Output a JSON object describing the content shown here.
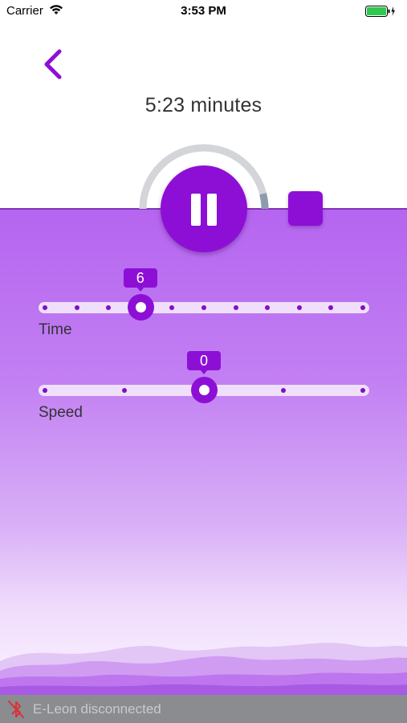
{
  "status_bar": {
    "carrier": "Carrier",
    "time": "3:53 PM",
    "battery_color": "#2ec94e"
  },
  "header": {
    "back_icon": "chevron-left-icon",
    "timer_text": "5:23 minutes"
  },
  "player": {
    "pause_icon": "pause-icon",
    "stop_icon": "stop-icon",
    "accent_color": "#8d0fd6",
    "progress_fraction": 0.92
  },
  "sliders": {
    "time": {
      "label": "Time",
      "value": "6",
      "steps": 11,
      "index": 3
    },
    "speed": {
      "label": "Speed",
      "value": "0",
      "steps": 5,
      "index": 2
    }
  },
  "footer": {
    "bluetooth_icon": "bluetooth-disabled-icon",
    "connection_status": "E-Leon disconnected"
  }
}
